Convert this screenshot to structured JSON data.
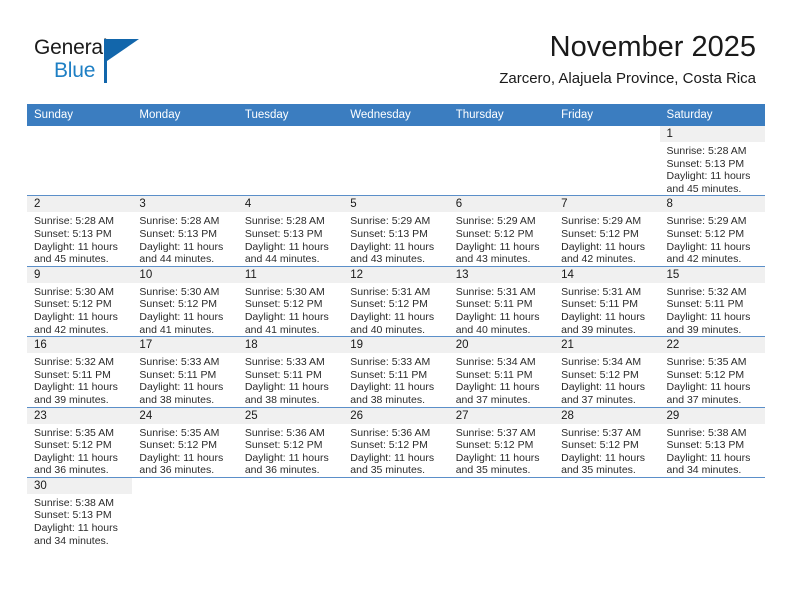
{
  "brand": {
    "name_part1": "General",
    "name_part2": "Blue",
    "logo_icon": "triangle-flag-icon",
    "accent_color": "#1266ab",
    "text_color": "#1e7fc4"
  },
  "header": {
    "month_title": "November 2025",
    "location": "Zarcero, Alajuela Province, Costa Rica"
  },
  "theme": {
    "header_row_bg": "#3b7dc0",
    "header_row_text": "#ffffff",
    "daynum_band_bg": "#f0f0f0",
    "cell_border": "#5b8fc9",
    "page_bg": "#ffffff"
  },
  "calendar": {
    "weekday_headers": [
      "Sunday",
      "Monday",
      "Tuesday",
      "Wednesday",
      "Thursday",
      "Friday",
      "Saturday"
    ],
    "weeks": [
      [
        {
          "day": "",
          "lines": [],
          "blank": true
        },
        {
          "day": "",
          "lines": [],
          "blank": true
        },
        {
          "day": "",
          "lines": [],
          "blank": true
        },
        {
          "day": "",
          "lines": [],
          "blank": true
        },
        {
          "day": "",
          "lines": [],
          "blank": true
        },
        {
          "day": "",
          "lines": [],
          "blank": true
        },
        {
          "day": "1",
          "lines": [
            "Sunrise: 5:28 AM",
            "Sunset: 5:13 PM",
            "Daylight: 11 hours",
            "and 45 minutes."
          ],
          "blank": false
        }
      ],
      [
        {
          "day": "2",
          "lines": [
            "Sunrise: 5:28 AM",
            "Sunset: 5:13 PM",
            "Daylight: 11 hours",
            "and 45 minutes."
          ],
          "blank": false
        },
        {
          "day": "3",
          "lines": [
            "Sunrise: 5:28 AM",
            "Sunset: 5:13 PM",
            "Daylight: 11 hours",
            "and 44 minutes."
          ],
          "blank": false
        },
        {
          "day": "4",
          "lines": [
            "Sunrise: 5:28 AM",
            "Sunset: 5:13 PM",
            "Daylight: 11 hours",
            "and 44 minutes."
          ],
          "blank": false
        },
        {
          "day": "5",
          "lines": [
            "Sunrise: 5:29 AM",
            "Sunset: 5:13 PM",
            "Daylight: 11 hours",
            "and 43 minutes."
          ],
          "blank": false
        },
        {
          "day": "6",
          "lines": [
            "Sunrise: 5:29 AM",
            "Sunset: 5:12 PM",
            "Daylight: 11 hours",
            "and 43 minutes."
          ],
          "blank": false
        },
        {
          "day": "7",
          "lines": [
            "Sunrise: 5:29 AM",
            "Sunset: 5:12 PM",
            "Daylight: 11 hours",
            "and 42 minutes."
          ],
          "blank": false
        },
        {
          "day": "8",
          "lines": [
            "Sunrise: 5:29 AM",
            "Sunset: 5:12 PM",
            "Daylight: 11 hours",
            "and 42 minutes."
          ],
          "blank": false
        }
      ],
      [
        {
          "day": "9",
          "lines": [
            "Sunrise: 5:30 AM",
            "Sunset: 5:12 PM",
            "Daylight: 11 hours",
            "and 42 minutes."
          ],
          "blank": false
        },
        {
          "day": "10",
          "lines": [
            "Sunrise: 5:30 AM",
            "Sunset: 5:12 PM",
            "Daylight: 11 hours",
            "and 41 minutes."
          ],
          "blank": false
        },
        {
          "day": "11",
          "lines": [
            "Sunrise: 5:30 AM",
            "Sunset: 5:12 PM",
            "Daylight: 11 hours",
            "and 41 minutes."
          ],
          "blank": false
        },
        {
          "day": "12",
          "lines": [
            "Sunrise: 5:31 AM",
            "Sunset: 5:12 PM",
            "Daylight: 11 hours",
            "and 40 minutes."
          ],
          "blank": false
        },
        {
          "day": "13",
          "lines": [
            "Sunrise: 5:31 AM",
            "Sunset: 5:11 PM",
            "Daylight: 11 hours",
            "and 40 minutes."
          ],
          "blank": false
        },
        {
          "day": "14",
          "lines": [
            "Sunrise: 5:31 AM",
            "Sunset: 5:11 PM",
            "Daylight: 11 hours",
            "and 39 minutes."
          ],
          "blank": false
        },
        {
          "day": "15",
          "lines": [
            "Sunrise: 5:32 AM",
            "Sunset: 5:11 PM",
            "Daylight: 11 hours",
            "and 39 minutes."
          ],
          "blank": false
        }
      ],
      [
        {
          "day": "16",
          "lines": [
            "Sunrise: 5:32 AM",
            "Sunset: 5:11 PM",
            "Daylight: 11 hours",
            "and 39 minutes."
          ],
          "blank": false
        },
        {
          "day": "17",
          "lines": [
            "Sunrise: 5:33 AM",
            "Sunset: 5:11 PM",
            "Daylight: 11 hours",
            "and 38 minutes."
          ],
          "blank": false
        },
        {
          "day": "18",
          "lines": [
            "Sunrise: 5:33 AM",
            "Sunset: 5:11 PM",
            "Daylight: 11 hours",
            "and 38 minutes."
          ],
          "blank": false
        },
        {
          "day": "19",
          "lines": [
            "Sunrise: 5:33 AM",
            "Sunset: 5:11 PM",
            "Daylight: 11 hours",
            "and 38 minutes."
          ],
          "blank": false
        },
        {
          "day": "20",
          "lines": [
            "Sunrise: 5:34 AM",
            "Sunset: 5:11 PM",
            "Daylight: 11 hours",
            "and 37 minutes."
          ],
          "blank": false
        },
        {
          "day": "21",
          "lines": [
            "Sunrise: 5:34 AM",
            "Sunset: 5:12 PM",
            "Daylight: 11 hours",
            "and 37 minutes."
          ],
          "blank": false
        },
        {
          "day": "22",
          "lines": [
            "Sunrise: 5:35 AM",
            "Sunset: 5:12 PM",
            "Daylight: 11 hours",
            "and 37 minutes."
          ],
          "blank": false
        }
      ],
      [
        {
          "day": "23",
          "lines": [
            "Sunrise: 5:35 AM",
            "Sunset: 5:12 PM",
            "Daylight: 11 hours",
            "and 36 minutes."
          ],
          "blank": false
        },
        {
          "day": "24",
          "lines": [
            "Sunrise: 5:35 AM",
            "Sunset: 5:12 PM",
            "Daylight: 11 hours",
            "and 36 minutes."
          ],
          "blank": false
        },
        {
          "day": "25",
          "lines": [
            "Sunrise: 5:36 AM",
            "Sunset: 5:12 PM",
            "Daylight: 11 hours",
            "and 36 minutes."
          ],
          "blank": false
        },
        {
          "day": "26",
          "lines": [
            "Sunrise: 5:36 AM",
            "Sunset: 5:12 PM",
            "Daylight: 11 hours",
            "and 35 minutes."
          ],
          "blank": false
        },
        {
          "day": "27",
          "lines": [
            "Sunrise: 5:37 AM",
            "Sunset: 5:12 PM",
            "Daylight: 11 hours",
            "and 35 minutes."
          ],
          "blank": false
        },
        {
          "day": "28",
          "lines": [
            "Sunrise: 5:37 AM",
            "Sunset: 5:12 PM",
            "Daylight: 11 hours",
            "and 35 minutes."
          ],
          "blank": false
        },
        {
          "day": "29",
          "lines": [
            "Sunrise: 5:38 AM",
            "Sunset: 5:13 PM",
            "Daylight: 11 hours",
            "and 34 minutes."
          ],
          "blank": false
        }
      ],
      [
        {
          "day": "30",
          "lines": [
            "Sunrise: 5:38 AM",
            "Sunset: 5:13 PM",
            "Daylight: 11 hours",
            "and 34 minutes."
          ],
          "blank": false
        },
        {
          "day": "",
          "lines": [],
          "blank": true
        },
        {
          "day": "",
          "lines": [],
          "blank": true
        },
        {
          "day": "",
          "lines": [],
          "blank": true
        },
        {
          "day": "",
          "lines": [],
          "blank": true
        },
        {
          "day": "",
          "lines": [],
          "blank": true
        },
        {
          "day": "",
          "lines": [],
          "blank": true
        }
      ]
    ]
  }
}
